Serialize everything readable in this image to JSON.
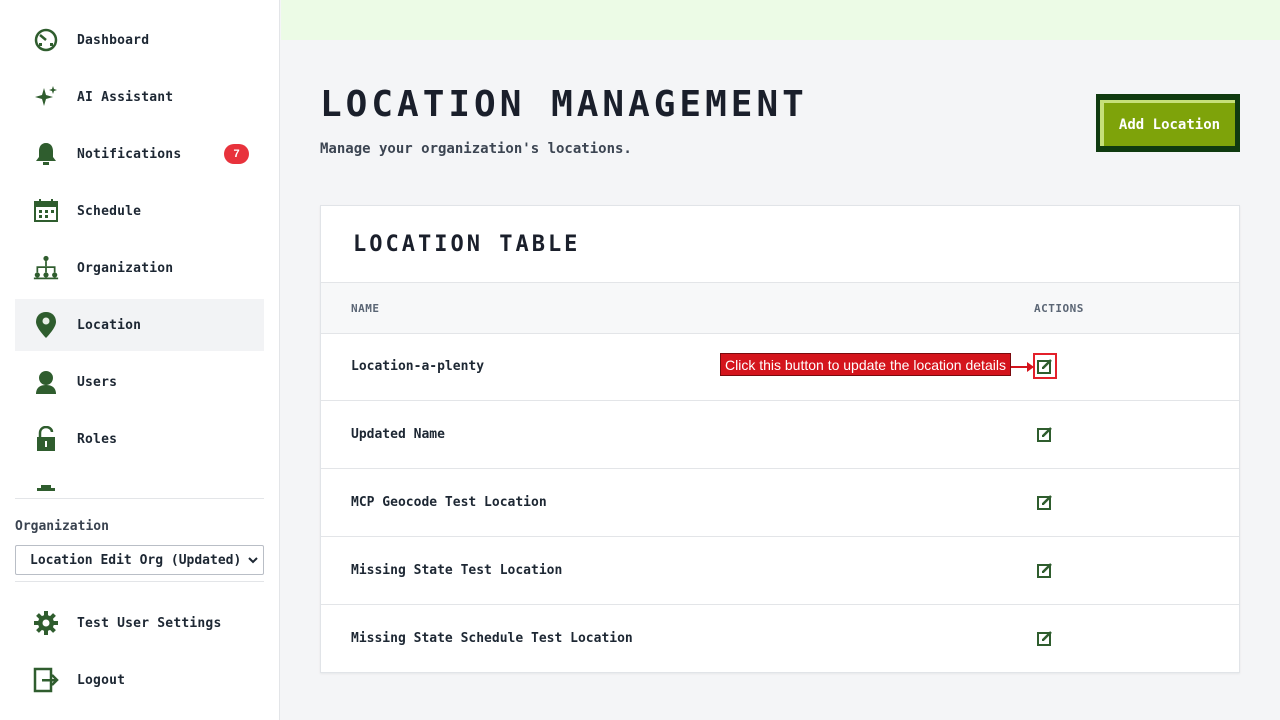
{
  "sidebar": {
    "items": [
      {
        "label": "Dashboard",
        "icon": "dashboard-icon"
      },
      {
        "label": "AI Assistant",
        "icon": "sparkle-icon"
      },
      {
        "label": "Notifications",
        "icon": "bell-icon",
        "badge": "7"
      },
      {
        "label": "Schedule",
        "icon": "calendar-icon"
      },
      {
        "label": "Organization",
        "icon": "org-chart-icon"
      },
      {
        "label": "Location",
        "icon": "map-pin-icon",
        "active": true
      },
      {
        "label": "Users",
        "icon": "user-icon"
      },
      {
        "label": "Roles",
        "icon": "lock-icon"
      }
    ],
    "org_label": "Organization",
    "org_selected": "Location Edit Org (Updated)",
    "settings_label": "Test User Settings",
    "logout_label": "Logout"
  },
  "page": {
    "title": "LOCATION MANAGEMENT",
    "subtitle": "Manage your organization's locations.",
    "add_button": "Add Location"
  },
  "table": {
    "title": "LOCATION TABLE",
    "columns": [
      "NAME",
      "ACTIONS"
    ],
    "rows": [
      {
        "name": "Location-a-plenty"
      },
      {
        "name": "Updated Name"
      },
      {
        "name": "MCP Geocode Test Location"
      },
      {
        "name": "Missing State Test Location"
      },
      {
        "name": "Missing State Schedule Test Location"
      }
    ]
  },
  "callout": {
    "text": "Click this button to update the location details"
  },
  "colors": {
    "accent_green": "#2f5d2e",
    "button_green": "#7ea30a",
    "badge_red": "#e8323c",
    "callout_red": "#d4141c"
  }
}
